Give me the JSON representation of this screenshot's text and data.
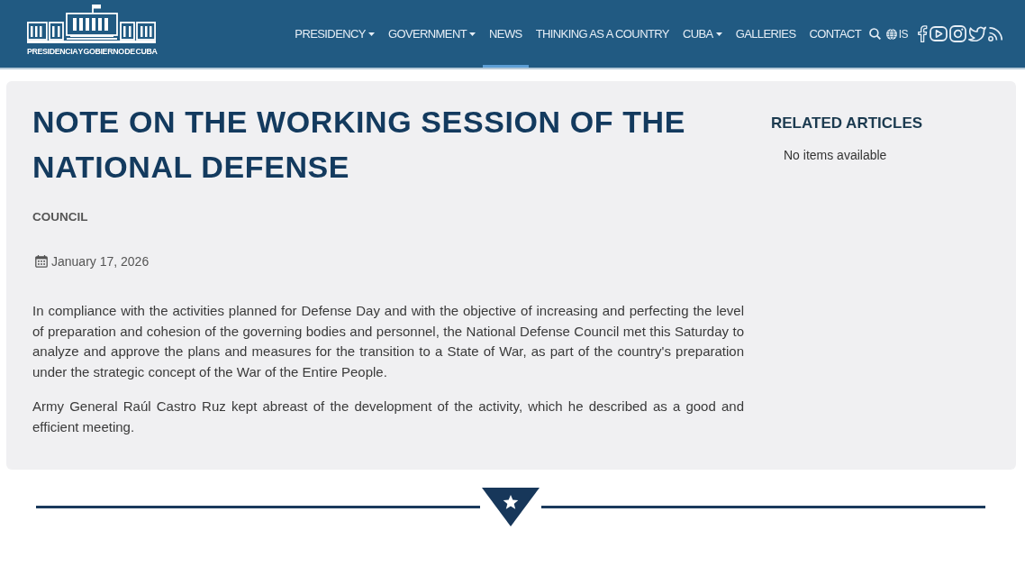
{
  "header": {
    "logo_text": "PRESIDENCIA Y GOBIERNO DE CUBA",
    "nav": [
      {
        "label": "PRESIDENCY",
        "has_menu": true,
        "selected": false
      },
      {
        "label": "GOVERNMENT",
        "has_menu": true,
        "selected": false
      },
      {
        "label": "NEWS",
        "has_menu": false,
        "selected": true
      },
      {
        "label": "THINKING AS A COUNTRY",
        "has_menu": false,
        "selected": false
      },
      {
        "label": "CUBA",
        "has_menu": true,
        "selected": false
      },
      {
        "label": "GALLERIES",
        "has_menu": false,
        "selected": false
      },
      {
        "label": "CONTACT",
        "has_menu": false,
        "selected": false
      }
    ],
    "language": "IS"
  },
  "article": {
    "title": "NOTE ON THE WORKING SESSION OF THE NATIONAL DEFENSE",
    "category": "COUNCIL",
    "date": "January 17, 2026",
    "paragraphs": [
      "In compliance with the activities planned for Defense Day and with the objective of increasing and perfecting the level of preparation and cohesion of the governing bodies and personnel, the National Defense Council met this Saturday to analyze and approve the plans and measures for the transition to a State of War, as part of the country's preparation under the strategic concept of the War of the Entire People.",
      "Army General Raúl Castro Ruz kept abreast of the development of the activity, which he described as a good and efficient meeting."
    ]
  },
  "sidebar": {
    "heading": "RELATED ARTICLES",
    "empty_text": "No items available"
  }
}
